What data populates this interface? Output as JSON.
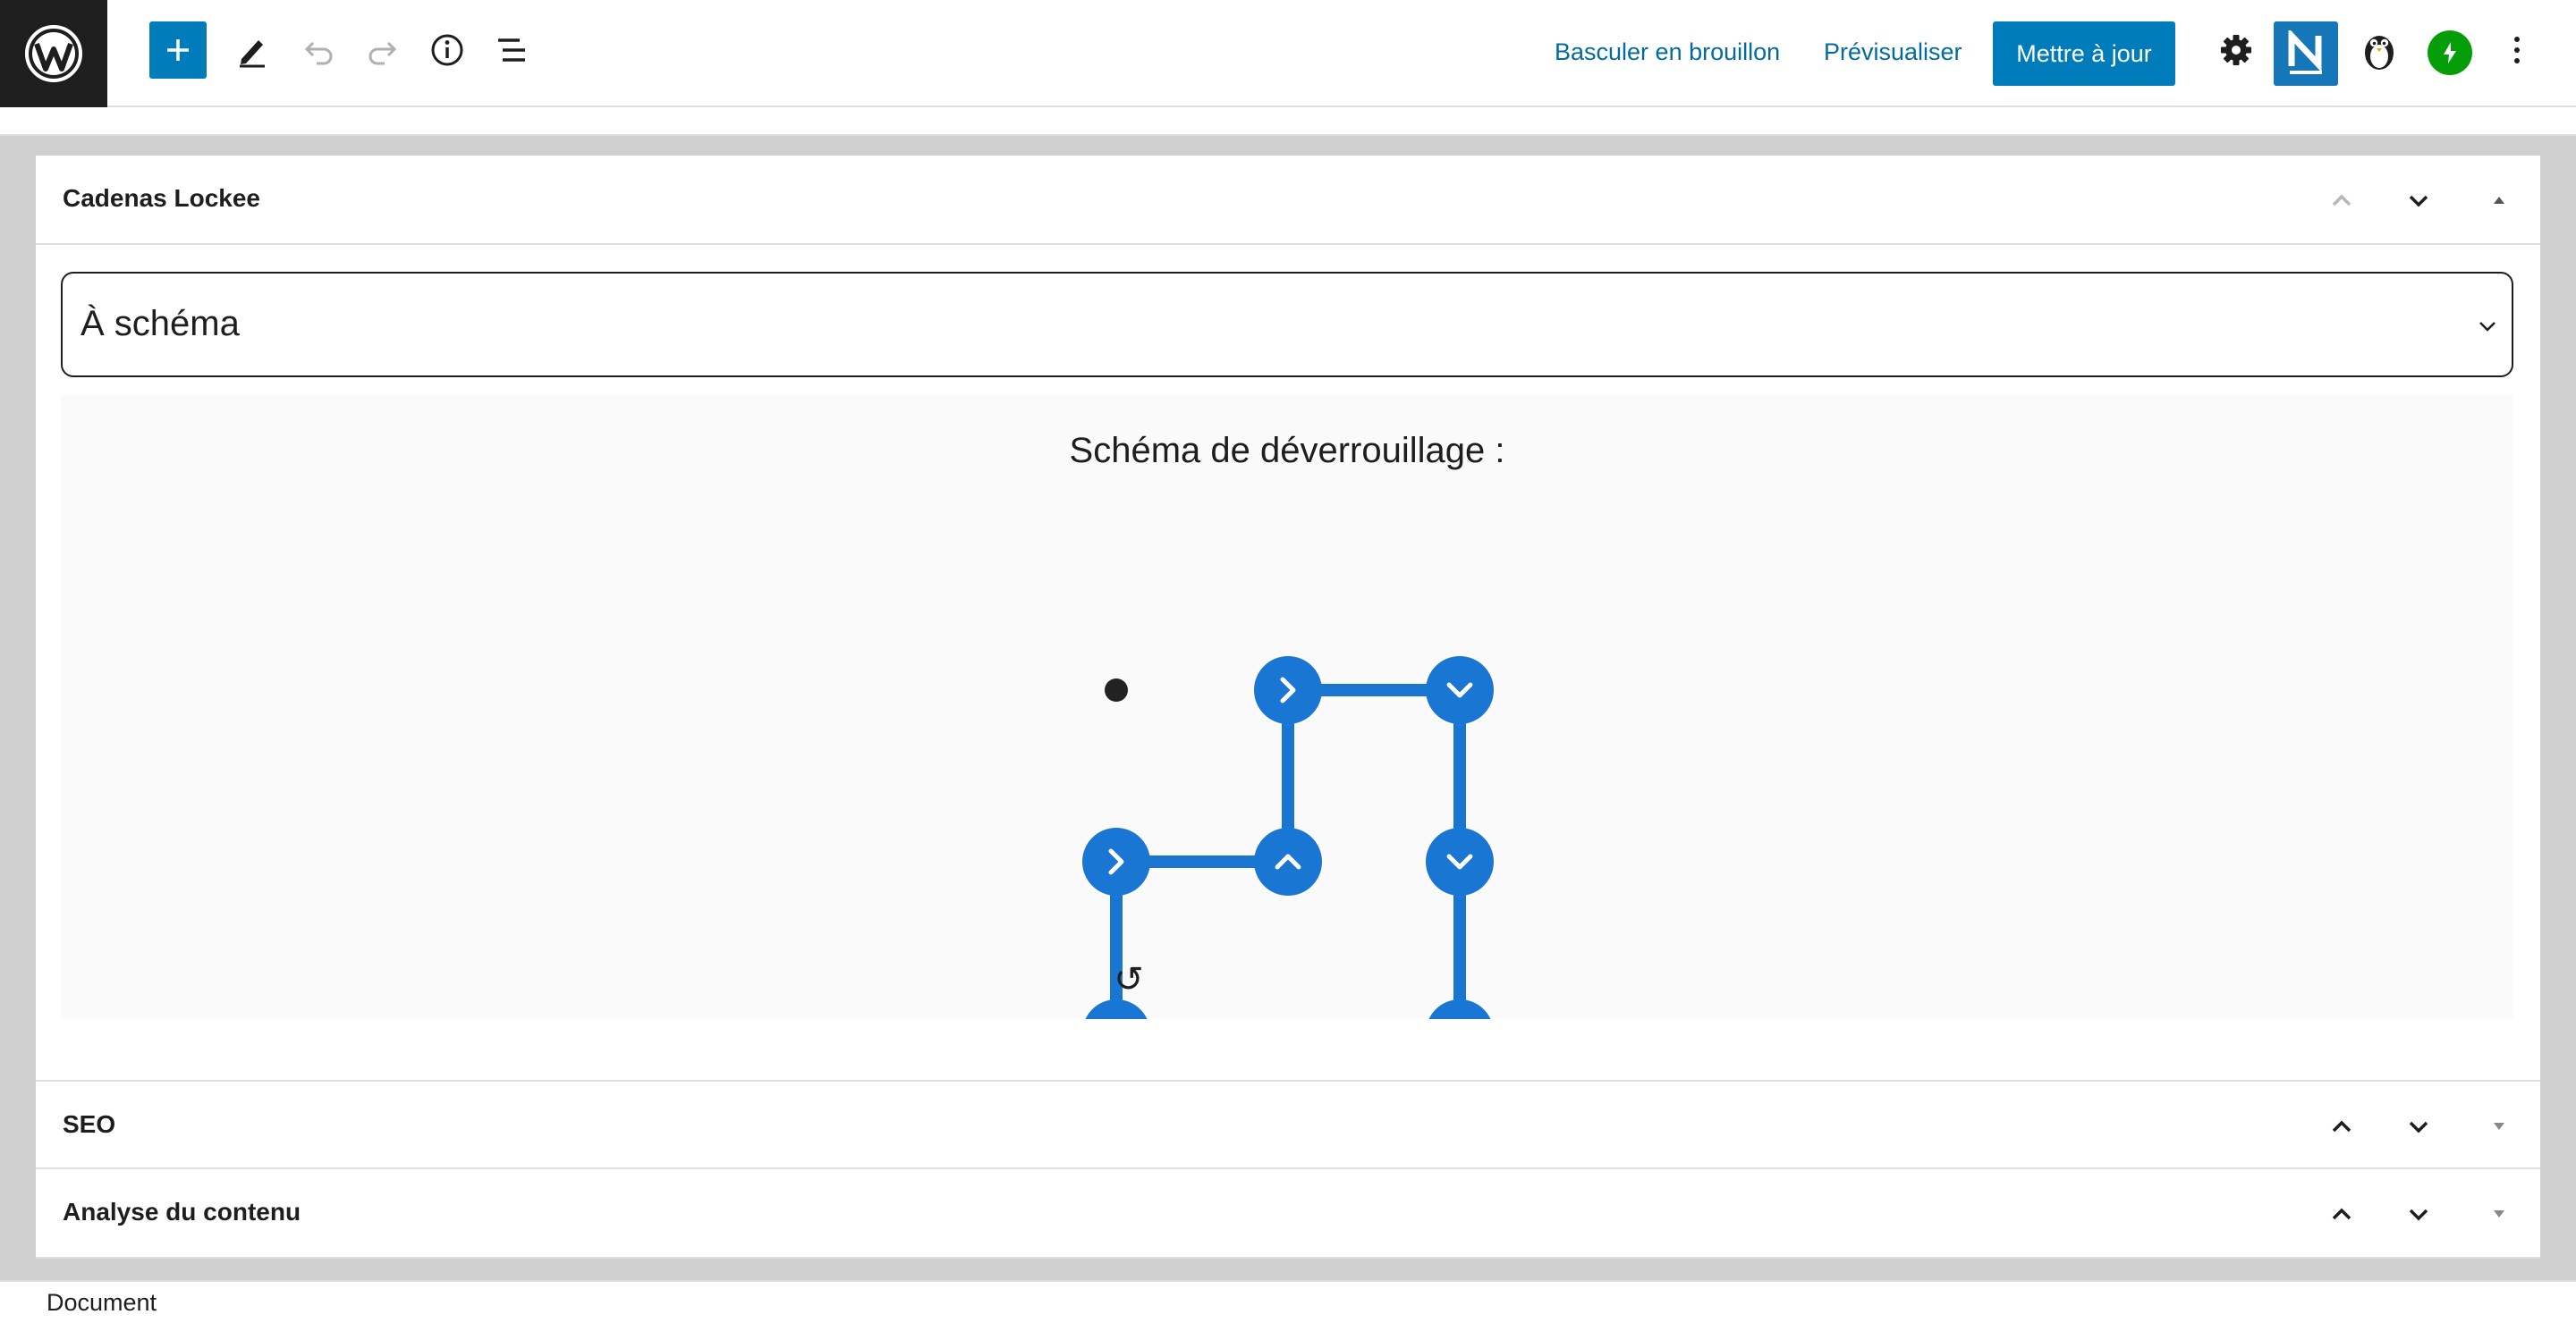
{
  "toolbar": {
    "logo_icon": "wordpress-logo-icon",
    "icons": [
      "plus-icon",
      "pencil-icon",
      "undo-icon",
      "redo-icon",
      "info-icon",
      "list-view-icon"
    ],
    "switch_draft_label": "Basculer en brouillon",
    "preview_label": "Prévisualiser",
    "update_label": "Mettre à jour",
    "right_icons": [
      "gear-icon",
      "n-plugin-icon",
      "penguin-icon",
      "jetpack-icon",
      "more-vertical-icon"
    ],
    "accent_color": "#007cba"
  },
  "metabox_lockee": {
    "title": "Cadenas Lockee",
    "type_select": {
      "value": "À schéma"
    },
    "pattern_title": "Schéma de déverrouillage :",
    "reset_symbol": "↺",
    "grid": [
      [
        null,
        "right",
        "down"
      ],
      [
        "right",
        "up",
        "down"
      ],
      [
        "up",
        null,
        "end"
      ]
    ],
    "path_sequence": [
      "r3c1",
      "r2c1",
      "r2c2",
      "r1c2",
      "r1c3",
      "r2c3",
      "r3c3"
    ],
    "path_color": "#1976d2"
  },
  "metabox_seo": {
    "title": "SEO"
  },
  "metabox_analysis": {
    "title": "Analyse du contenu"
  },
  "statusbar": {
    "label": "Document"
  }
}
